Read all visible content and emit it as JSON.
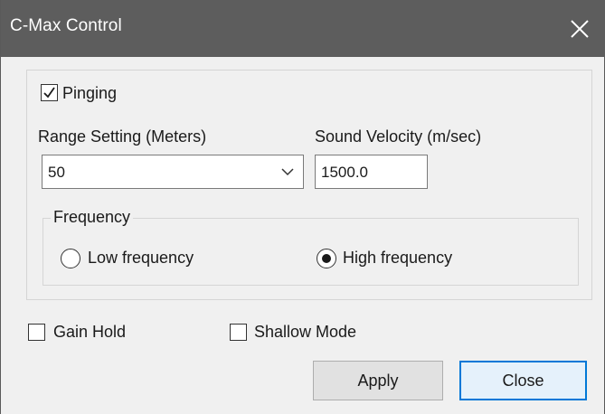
{
  "window": {
    "title": "C-Max Control",
    "close_icon": "close-icon"
  },
  "pinging": {
    "label": "Pinging",
    "checked": true
  },
  "range": {
    "label": "Range Setting (Meters)",
    "value": "50"
  },
  "sound_velocity": {
    "label": "Sound Velocity (m/sec)",
    "value": "1500.0"
  },
  "frequency": {
    "legend": "Frequency",
    "low_label": "Low frequency",
    "high_label": "High frequency",
    "selected": "High frequency"
  },
  "gain_hold": {
    "label": "Gain Hold",
    "checked": false
  },
  "shallow_mode": {
    "label": "Shallow Mode",
    "checked": false
  },
  "buttons": {
    "apply": "Apply",
    "close": "Close"
  },
  "colors": {
    "titlebar": "#5d5d5d",
    "dialog_bg": "#f0f0f0",
    "default_button_border": "#0078d7"
  }
}
